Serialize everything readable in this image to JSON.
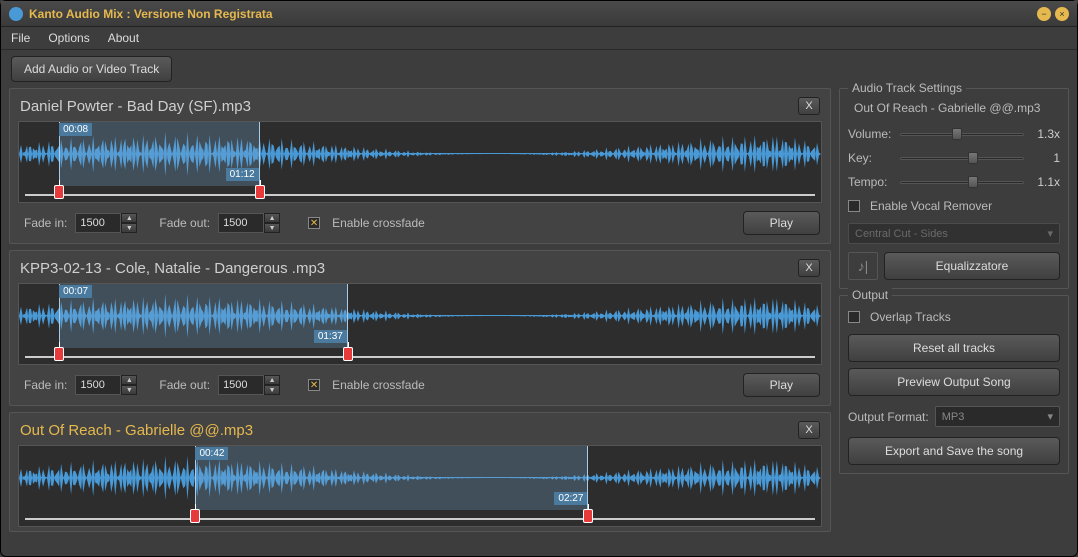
{
  "window": {
    "title": "Kanto Audio Mix : Versione Non Registrata"
  },
  "menu": {
    "file": "File",
    "options": "Options",
    "about": "About"
  },
  "toolbar": {
    "add": "Add Audio or Video Track"
  },
  "labels": {
    "fade_in": "Fade in:",
    "fade_out": "Fade out:",
    "crossfade": "Enable crossfade",
    "play": "Play",
    "close": "X"
  },
  "tracks": [
    {
      "title": "Daniel Powter - Bad Day (SF).mp3",
      "fade_in": "1500",
      "fade_out": "1500",
      "crossfade": true,
      "sel_start": "00:08",
      "sel_end": "01:12",
      "sel_left_pct": 5,
      "sel_right_pct": 30,
      "selected": false
    },
    {
      "title": "KPP3-02-13 - Cole, Natalie - Dangerous .mp3",
      "fade_in": "1500",
      "fade_out": "1500",
      "crossfade": true,
      "sel_start": "00:07",
      "sel_end": "01:37",
      "sel_left_pct": 5,
      "sel_right_pct": 41,
      "selected": false
    },
    {
      "title": "Out Of Reach - Gabrielle @@.mp3",
      "fade_in": "1500",
      "fade_out": "1500",
      "crossfade": true,
      "sel_start": "00:42",
      "sel_end": "02:27",
      "sel_left_pct": 22,
      "sel_right_pct": 71,
      "selected": true
    }
  ],
  "settings": {
    "panel_title": "Audio Track Settings",
    "file": "Out Of Reach - Gabrielle @@.mp3",
    "volume_label": "Volume:",
    "volume_val": "1.3x",
    "volume_pct": 42,
    "key_label": "Key:",
    "key_val": "1",
    "key_pct": 55,
    "tempo_label": "Tempo:",
    "tempo_val": "1.1x",
    "tempo_pct": 55,
    "vocal_label": "Enable Vocal Remover",
    "vocal_mode": "Central Cut - Sides",
    "eq_label": "Equalizzatore"
  },
  "output": {
    "panel_title": "Output",
    "overlap": "Overlap Tracks",
    "reset": "Reset all tracks",
    "preview": "Preview Output Song",
    "format_label": "Output Format:",
    "format_value": "MP3",
    "export": "Export and Save the song"
  }
}
